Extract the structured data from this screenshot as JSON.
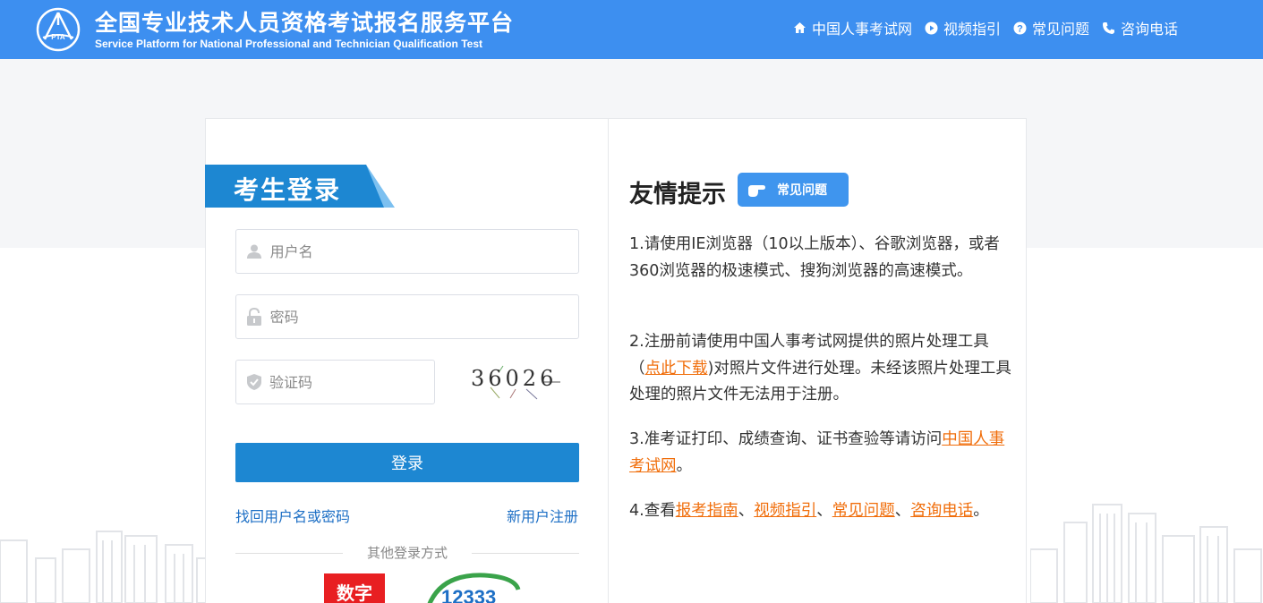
{
  "header": {
    "logo_text": "PTA",
    "title": "全国专业技术人员资格考试报名服务平台",
    "subtitle": "Service Platform for National Professional and Technician Qualification Test",
    "nav": [
      {
        "label": "中国人事考试网",
        "icon": "home-icon"
      },
      {
        "label": "视频指引",
        "icon": "play-icon"
      },
      {
        "label": "常见问题",
        "icon": "help-icon"
      },
      {
        "label": "咨询电话",
        "icon": "phone-icon"
      }
    ]
  },
  "login": {
    "title": "考生登录",
    "username_placeholder": "用户名",
    "password_placeholder": "密码",
    "captcha_placeholder": "验证码",
    "captcha_text": "36026",
    "login_button": "登录",
    "forgot_link": "找回用户名或密码",
    "register_link": "新用户注册",
    "other_methods": "其他登录方式",
    "digital_badge": "数字",
    "hotline_text": "12333"
  },
  "tips": {
    "title": "友情提示",
    "faq_badge": "常见问题",
    "tip1": "1.请使用IE浏览器（10以上版本）、谷歌浏览器，或者360浏览器的极速模式、搜狗浏览器的高速模式。",
    "tip2_pre": "2.注册前请使用中国人事考试网提供的照片处理工具（",
    "tip2_link": "点此下载",
    "tip2_post": ")对照片文件进行处理。未经该照片处理工具处理的照片文件无法用于注册。",
    "tip3_pre": "3.准考证打印、成绩查询、证书查验等请访问",
    "tip3_link": "中国人事考试网",
    "tip3_post": "。",
    "tip4_pre": "4.查看",
    "tip4_link1": "报考指南",
    "tip4_sep1": "、",
    "tip4_link2": "视频指引",
    "tip4_sep2": "、",
    "tip4_link3": "常见问题",
    "tip4_sep3": "、",
    "tip4_link4": "咨询电话",
    "tip4_post": "。"
  },
  "colors": {
    "header_bg": "#3d8ff0",
    "button_bg": "#1d87d2",
    "link": "#1d6fc5",
    "tip_link": "#f06d0a"
  }
}
